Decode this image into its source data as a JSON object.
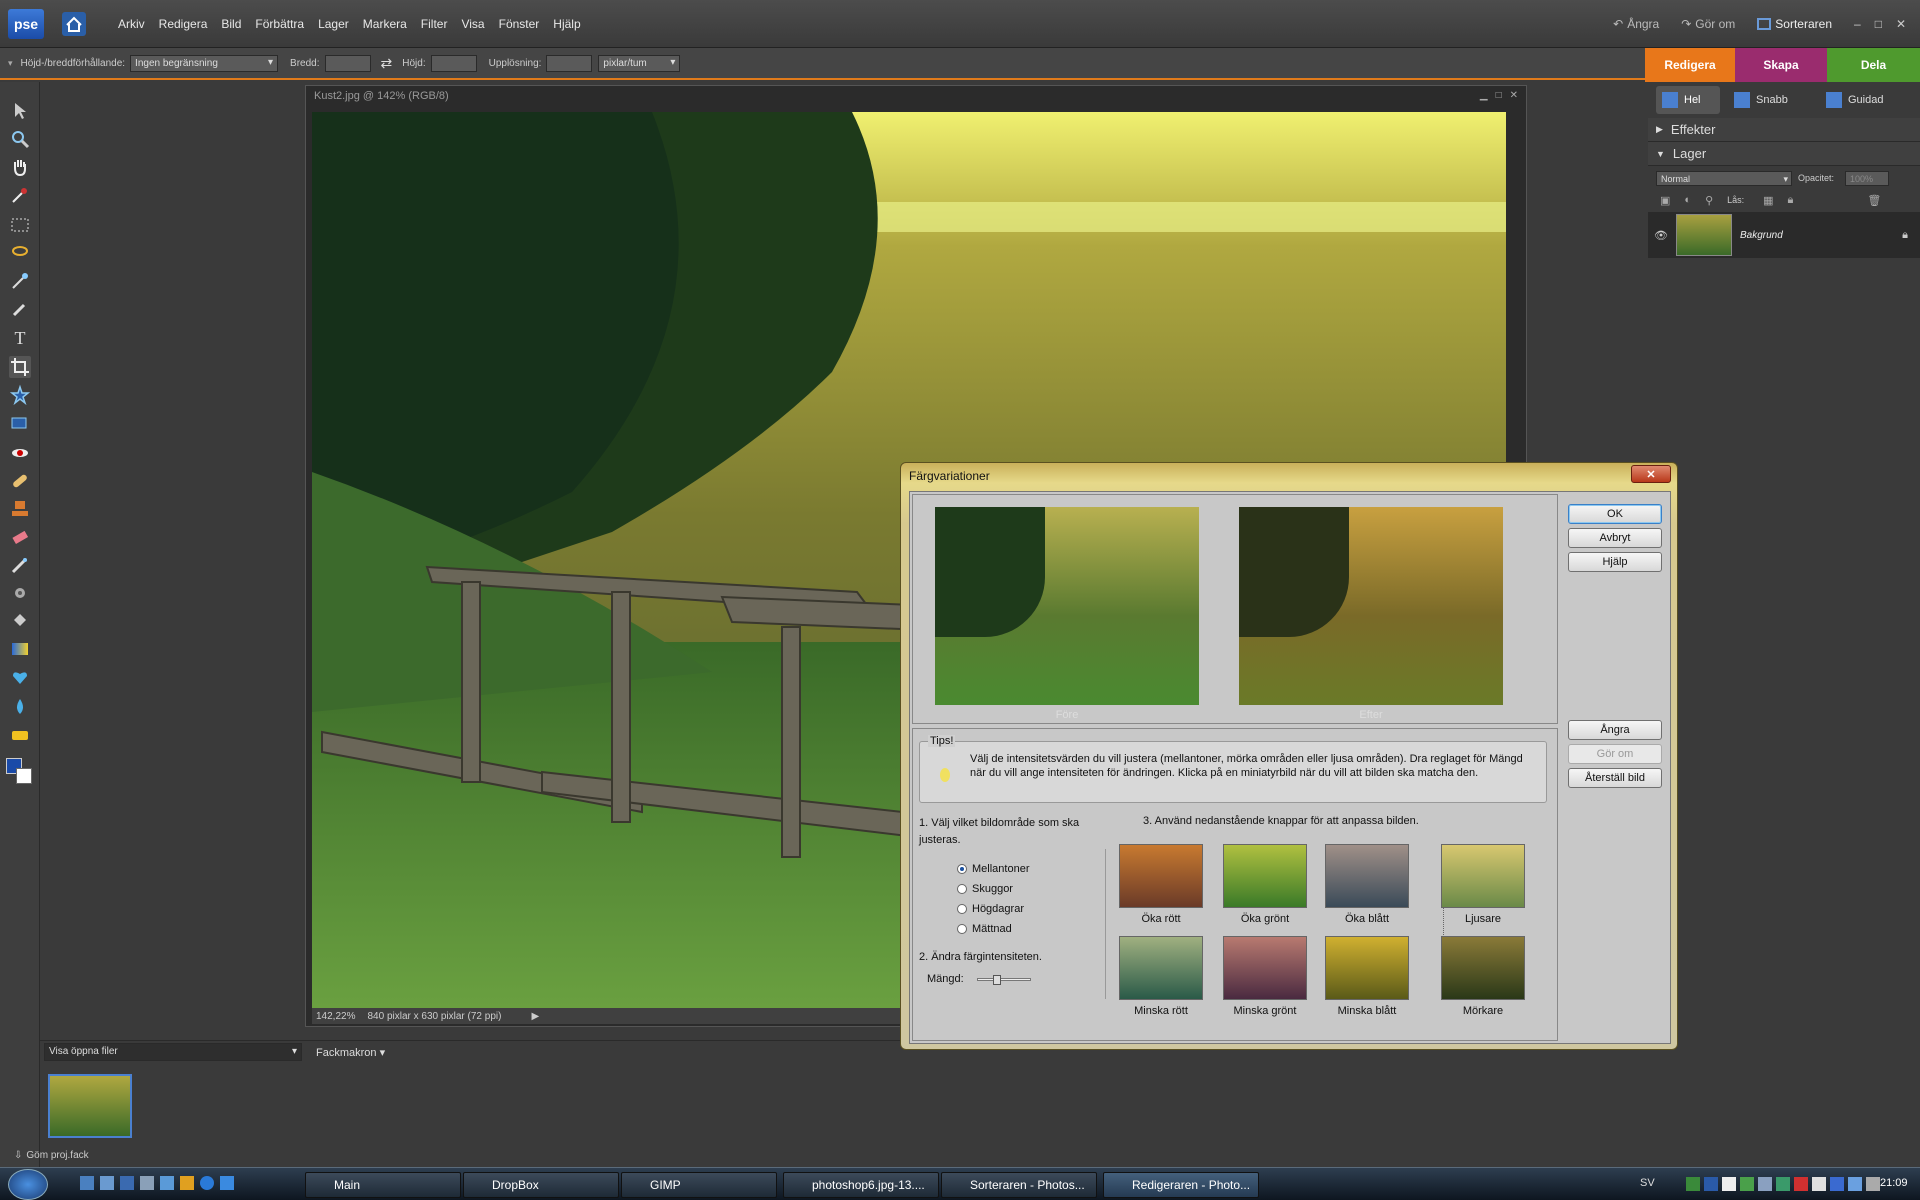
{
  "app": {
    "logo": "pse"
  },
  "menu": [
    "Arkiv",
    "Redigera",
    "Bild",
    "Förbättra",
    "Lager",
    "Markera",
    "Filter",
    "Visa",
    "Fönster",
    "Hjälp"
  ],
  "topright": {
    "undo": "Ångra",
    "redo": "Gör om",
    "organizer": "Sorteraren"
  },
  "options": {
    "aspect_label": "Höjd-/breddförhållande:",
    "aspect_value": "Ingen begränsning",
    "width_label": "Bredd:",
    "height_label": "Höjd:",
    "resolution_label": "Upplösning:",
    "resolution_unit": "pixlar/tum"
  },
  "mode_tabs": {
    "edit": "Redigera",
    "create": "Skapa",
    "share": "Dela"
  },
  "edit_modes": {
    "full": "Hel",
    "quick": "Snabb",
    "guided": "Guidad"
  },
  "document": {
    "title": "Kust2.jpg @ 142% (RGB/8)",
    "zoom": "142,22%",
    "info": "840 pixlar x 630 pixlar (72 ppi)"
  },
  "panels": {
    "effects": "Effekter",
    "layers": "Lager",
    "blend_mode": "Normal",
    "opacity_label": "Opacitet:",
    "opacity_value": "100%",
    "lock_label": "Lås:",
    "layer_name": "Bakgrund"
  },
  "bin": {
    "show": "Visa öppna filer",
    "actions": "Fackmakron",
    "hide": "Göm proj.fack"
  },
  "dialog": {
    "title": "Färgvariationer",
    "before": "Före",
    "after": "Efter",
    "ok": "OK",
    "cancel": "Avbryt",
    "help": "Hjälp",
    "undo": "Ångra",
    "redo": "Gör om",
    "reset": "Återställ bild",
    "tips_title": "Tips!",
    "tips_text": "Välj de intensitetsvärden du vill justera (mellantoner, mörka områden eller ljusa områden). Dra reglaget för Mängd när du vill ange intensiteten för ändringen. Klicka på en miniatyrbild när du vill att bilden ska matcha den.",
    "step1": "1. Välj vilket bildområde som ska justeras.",
    "step2": "2. Ändra färgintensiteten.",
    "step3": "3. Använd nedanstående knappar för att anpassa bilden.",
    "areas": [
      "Mellantoner",
      "Skuggor",
      "Högdagrar",
      "Mättnad"
    ],
    "amount_label": "Mängd:",
    "amount_value": 0.35,
    "variations": [
      "Öka rött",
      "Öka grönt",
      "Öka blått",
      "Ljusare",
      "Minska rött",
      "Minska grönt",
      "Minska blått",
      "Mörkare"
    ]
  },
  "taskbar": {
    "items": [
      "Main",
      "DropBox",
      "GIMP",
      "photoshop6.jpg-13....",
      "Sorteraren - Photos...",
      "Redigeraren - Photo..."
    ],
    "lang": "SV",
    "time": "21:09"
  }
}
